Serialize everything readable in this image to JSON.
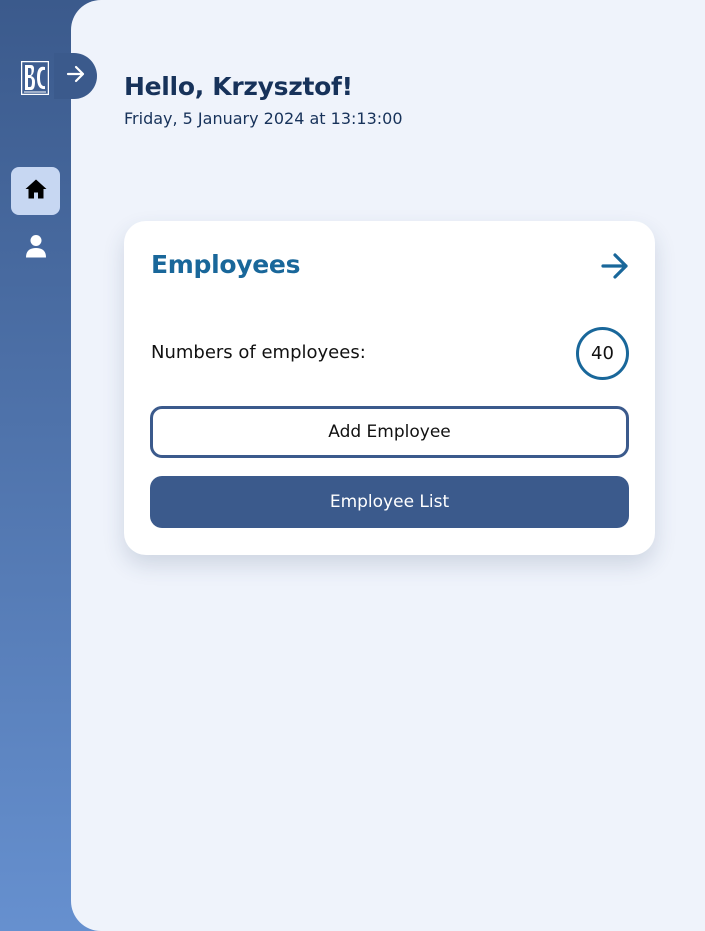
{
  "sidebar": {
    "logo_text": "BC",
    "expand_icon": "arrow-right-icon",
    "items": [
      {
        "id": "home",
        "icon": "home-icon",
        "active": true
      },
      {
        "id": "profile",
        "icon": "user-icon",
        "active": false
      }
    ]
  },
  "header": {
    "greeting": "Hello, Krzysztof!",
    "datetime": "Friday, 5 January 2024 at 13:13:00"
  },
  "employees_card": {
    "title": "Employees",
    "count_label": "Numbers of employees:",
    "count": "40",
    "add_button_label": "Add Employee",
    "list_button_label": "Employee List",
    "arrow_icon": "arrow-right-icon"
  },
  "colors": {
    "sidebar_top": "#3b5a8c",
    "sidebar_bottom": "#6690cf",
    "main_background": "#eff3fb",
    "title_blue": "#19679a",
    "dark_navy": "#17325a",
    "button_blue": "#3b5a8c",
    "active_nav": "#c7d7f2"
  }
}
